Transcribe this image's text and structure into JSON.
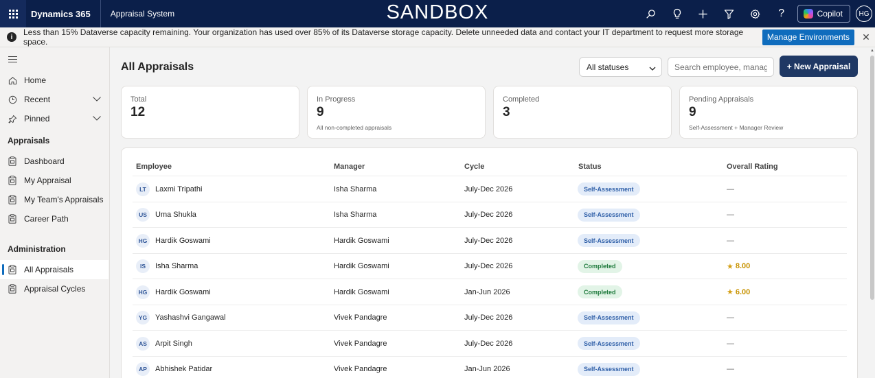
{
  "topbar": {
    "brand": "Dynamics 365",
    "app_name": "Appraisal System",
    "environment_label": "SANDBOX",
    "copilot_label": "Copilot",
    "user_initials": "HG",
    "icons": [
      "waffle-icon",
      "search-icon",
      "lightbulb-icon",
      "plus-icon",
      "filter-icon",
      "gear-icon",
      "help-icon"
    ]
  },
  "notice": {
    "message": "Less than 15% Dataverse capacity remaining. Your organization has used over 85% of its Dataverse storage capacity. Delete unneeded data and contact your IT department to request more storage space.",
    "action_label": "Manage Environments",
    "close_symbol": "✕"
  },
  "sidebar": {
    "top_items": [
      {
        "label": "Home",
        "icon": "home-icon"
      },
      {
        "label": "Recent",
        "icon": "clock-icon"
      },
      {
        "label": "Pinned",
        "icon": "pin-icon"
      }
    ],
    "sections": [
      {
        "title": "Appraisals",
        "items": [
          {
            "label": "Dashboard",
            "icon": "clipboard-icon"
          },
          {
            "label": "My Appraisal",
            "icon": "clipboard-icon"
          },
          {
            "label": "My Team's Appraisals",
            "icon": "clipboard-icon"
          },
          {
            "label": "Career Path",
            "icon": "clipboard-icon"
          }
        ]
      },
      {
        "title": "Administration",
        "items": [
          {
            "label": "All Appraisals",
            "icon": "clipboard-icon",
            "active": true
          },
          {
            "label": "Appraisal Cycles",
            "icon": "clipboard-icon"
          }
        ]
      }
    ]
  },
  "main": {
    "title": "All Appraisals",
    "status_filter": "All statuses",
    "search_placeholder": "Search employee, manager",
    "new_button": "+ New Appraisal",
    "cards": [
      {
        "label": "Total",
        "value": "12",
        "sub": ""
      },
      {
        "label": "In Progress",
        "value": "9",
        "sub": "All non-completed appraisals"
      },
      {
        "label": "Completed",
        "value": "3",
        "sub": ""
      },
      {
        "label": "Pending Appraisals",
        "value": "9",
        "sub": "Self-Assessment + Manager Review"
      }
    ],
    "table": {
      "headers": [
        "Employee",
        "Manager",
        "Cycle",
        "Status",
        "Overall Rating"
      ],
      "rows": [
        {
          "initials": "LT",
          "employee": "Laxmi Tripathi",
          "manager": "Isha Sharma",
          "cycle": "July-Dec 2026",
          "status": "Self-Assessment",
          "status_type": "self",
          "rating": "—"
        },
        {
          "initials": "US",
          "employee": "Uma Shukla",
          "manager": "Isha Sharma",
          "cycle": "July-Dec 2026",
          "status": "Self-Assessment",
          "status_type": "self",
          "rating": "—"
        },
        {
          "initials": "HG",
          "employee": "Hardik Goswami",
          "manager": "Hardik Goswami",
          "cycle": "July-Dec 2026",
          "status": "Self-Assessment",
          "status_type": "self",
          "rating": "—"
        },
        {
          "initials": "IS",
          "employee": "Isha Sharma",
          "manager": "Hardik Goswami",
          "cycle": "July-Dec 2026",
          "status": "Completed",
          "status_type": "done",
          "rating": "8.00"
        },
        {
          "initials": "HG",
          "employee": "Hardik Goswami",
          "manager": "Hardik Goswami",
          "cycle": "Jan-Jun 2026",
          "status": "Completed",
          "status_type": "done",
          "rating": "6.00"
        },
        {
          "initials": "YG",
          "employee": "Yashashvi Gangawal",
          "manager": "Vivek Pandagre",
          "cycle": "July-Dec 2026",
          "status": "Self-Assessment",
          "status_type": "self",
          "rating": "—"
        },
        {
          "initials": "AS",
          "employee": "Arpit Singh",
          "manager": "Vivek Pandagre",
          "cycle": "July-Dec 2026",
          "status": "Self-Assessment",
          "status_type": "self",
          "rating": "—"
        },
        {
          "initials": "AP",
          "employee": "Abhishek Patidar",
          "manager": "Vivek Pandagre",
          "cycle": "Jan-Jun 2026",
          "status": "Self-Assessment",
          "status_type": "self",
          "rating": "—"
        }
      ]
    }
  },
  "colors": {
    "topbar_bg": "#0b1f4a",
    "accent_blue": "#0f6cbd",
    "primary_button": "#1f3864",
    "rating_gold": "#c79200"
  }
}
